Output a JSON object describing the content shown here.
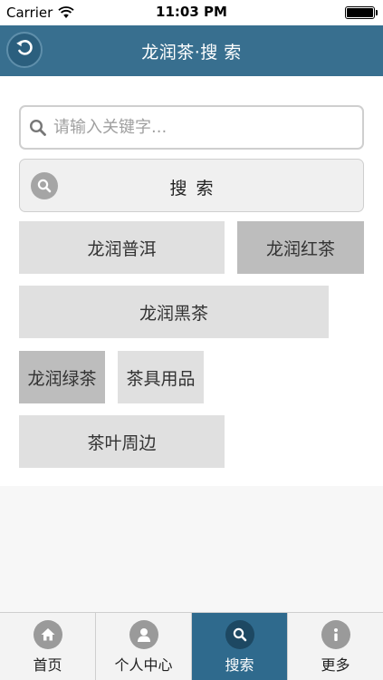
{
  "status_bar": {
    "carrier": "Carrier",
    "time": "11:03 PM"
  },
  "nav": {
    "title": "龙润茶·搜 索"
  },
  "search": {
    "placeholder": "请输入关键字...",
    "value": "",
    "button_label": "搜 索"
  },
  "tags": [
    {
      "label": "龙润普洱",
      "style": "light"
    },
    {
      "label": "龙润红茶",
      "style": "dark"
    },
    {
      "label": "龙润黑茶",
      "style": "light"
    },
    {
      "label": "龙润绿茶",
      "style": "dark"
    },
    {
      "label": "茶具用品",
      "style": "light"
    },
    {
      "label": "茶叶周边",
      "style": "light"
    }
  ],
  "tab_bar": {
    "items": [
      {
        "label": "首页",
        "icon": "home-icon",
        "active": false
      },
      {
        "label": "个人中心",
        "icon": "user-icon",
        "active": false
      },
      {
        "label": "搜索",
        "icon": "search-icon",
        "active": true
      },
      {
        "label": "更多",
        "icon": "info-icon",
        "active": false
      }
    ]
  },
  "colors": {
    "nav_background": "#386f8f",
    "active_tab": "#2f6a8d",
    "tag_light": "#e0e0e0",
    "tag_dark": "#bdbdbd"
  }
}
